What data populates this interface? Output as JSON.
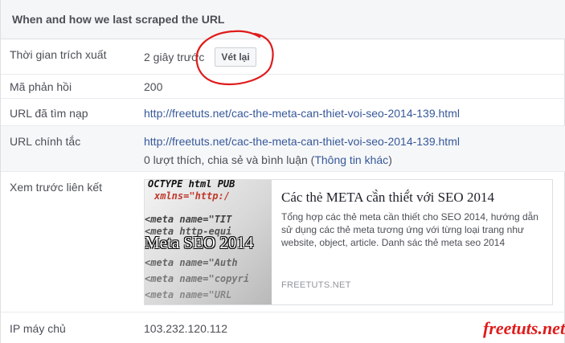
{
  "header": {
    "title": "When and how we last scraped the URL"
  },
  "rows": {
    "fetch_time": {
      "label": "Thời gian trích xuất",
      "value": "2 giây trước",
      "button": "Vét lại"
    },
    "response_code": {
      "label": "Mã phản hồi",
      "value": "200"
    },
    "fetched_url": {
      "label": "URL đã tìm nạp",
      "value": "http://freetuts.net/cac-the-meta-can-thiet-voi-seo-2014-139.html"
    },
    "canonical_url": {
      "label": "URL chính tắc",
      "value": "http://freetuts.net/cac-the-meta-can-thiet-voi-seo-2014-139.html",
      "social_text": "0 lượt thích, chia sẻ và bình luận (",
      "more_info": "Thông tin khác",
      "close_paren": ")"
    },
    "link_preview": {
      "label": "Xem trước liên kết"
    },
    "server_ip": {
      "label": "IP máy chủ",
      "value": "103.232.120.112"
    }
  },
  "preview": {
    "title": "Các thẻ META cầ̀n thiế́t với SEO 2014",
    "description": "Tổng hợp các thẻ meta cần thiết cho SEO 2014, hướng dẫn sử dụng các thẻ meta tương ứng với từng loại trang như website, object, article. Danh sác thẻ meta seo 2014",
    "domain": "FREETUTS.NET",
    "thumbnail": {
      "overlay_title": "Meta SEO 2014",
      "code_lines": [
        "OCTYPE html PUB",
        "xmlns=\"http:/",
        "<meta name=\"TIT",
        "<meta http-equi",
        "<meta name=\"Auth",
        "<meta name=\"copyri",
        "<meta name=\"URL"
      ]
    }
  },
  "watermark": "freetuts.net",
  "colors": {
    "link": "#365899",
    "annotation": "#e01b1b",
    "header_bg": "#f5f6f7",
    "shaded_row": "#f6f7f9"
  }
}
